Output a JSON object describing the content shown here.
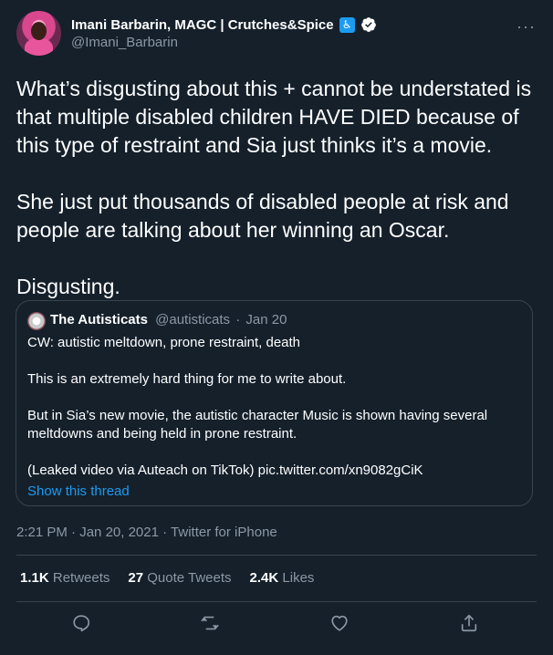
{
  "author": {
    "display_name": "Imani Barbarin, MAGC | Crutches&Spice",
    "handle": "@Imani_Barbarin"
  },
  "tweet": {
    "paragraphs": [
      "What’s disgusting about this + cannot be understated is that multiple disabled children HAVE DIED because of this type of restraint and Sia just thinks it’s a movie.",
      "She just put thousands of disabled people at risk and people are talking about her winning an Oscar.",
      "Disgusting."
    ]
  },
  "quote": {
    "name": "The Autisticats",
    "handle": "@autisticats",
    "date": "Jan 20",
    "paragraphs": [
      "CW: autistic meltdown, prone restraint, death",
      "This is an extremely hard thing for me to write about.",
      "But in Sia’s new movie, the autistic character Music is shown having several meltdowns and being held in prone restraint.",
      "(Leaked video via Auteach on TikTok) pic.twitter.com/xn9082gCiK"
    ],
    "show_thread": "Show this thread"
  },
  "meta": {
    "time": "2:21 PM",
    "date": "Jan 20, 2021",
    "source": "Twitter for iPhone"
  },
  "stats": {
    "retweets_count": "1.1K",
    "retweets_label": "Retweets",
    "quotes_count": "27",
    "quotes_label": "Quote Tweets",
    "likes_count": "2.4K",
    "likes_label": "Likes"
  },
  "icons": {
    "accessibility": "wheelchair-icon",
    "verified": "verified-badge-icon",
    "more": "more-icon",
    "reply": "reply-icon",
    "retweet": "retweet-icon",
    "like": "heart-icon",
    "share": "share-icon"
  },
  "colors": {
    "background": "#15202b",
    "accent": "#1d9bf0",
    "secondary_text": "#8b98a5",
    "border": "#38444d"
  }
}
